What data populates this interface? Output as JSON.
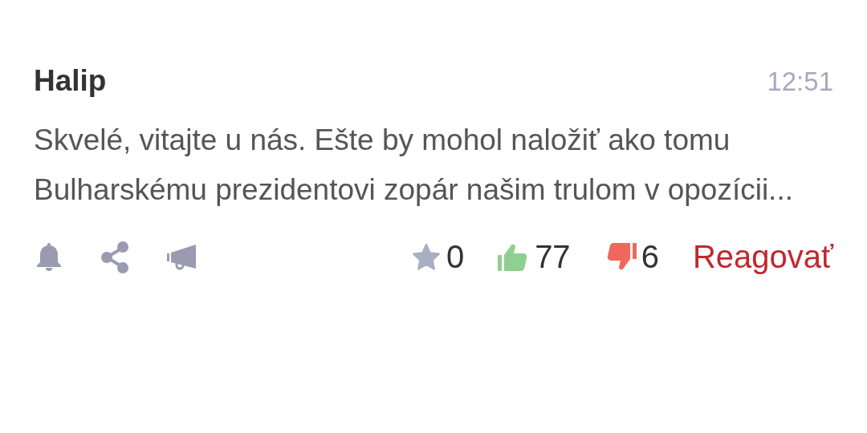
{
  "comment": {
    "author": "Halip",
    "time": "12:51",
    "text": "Skvelé, vitajte u nás. Ešte by mohol naložiť ako tomu Bulharskému prezidentovi zopár našim trulom v opozícii...",
    "actions": [
      {
        "kind": "bell"
      },
      {
        "kind": "share"
      },
      {
        "kind": "megaphone"
      }
    ],
    "counters": [
      {
        "kind": "star",
        "count": "0"
      },
      {
        "kind": "like",
        "count": "77"
      },
      {
        "kind": "dislike",
        "count": "6"
      }
    ],
    "reply": "Reagovať"
  }
}
